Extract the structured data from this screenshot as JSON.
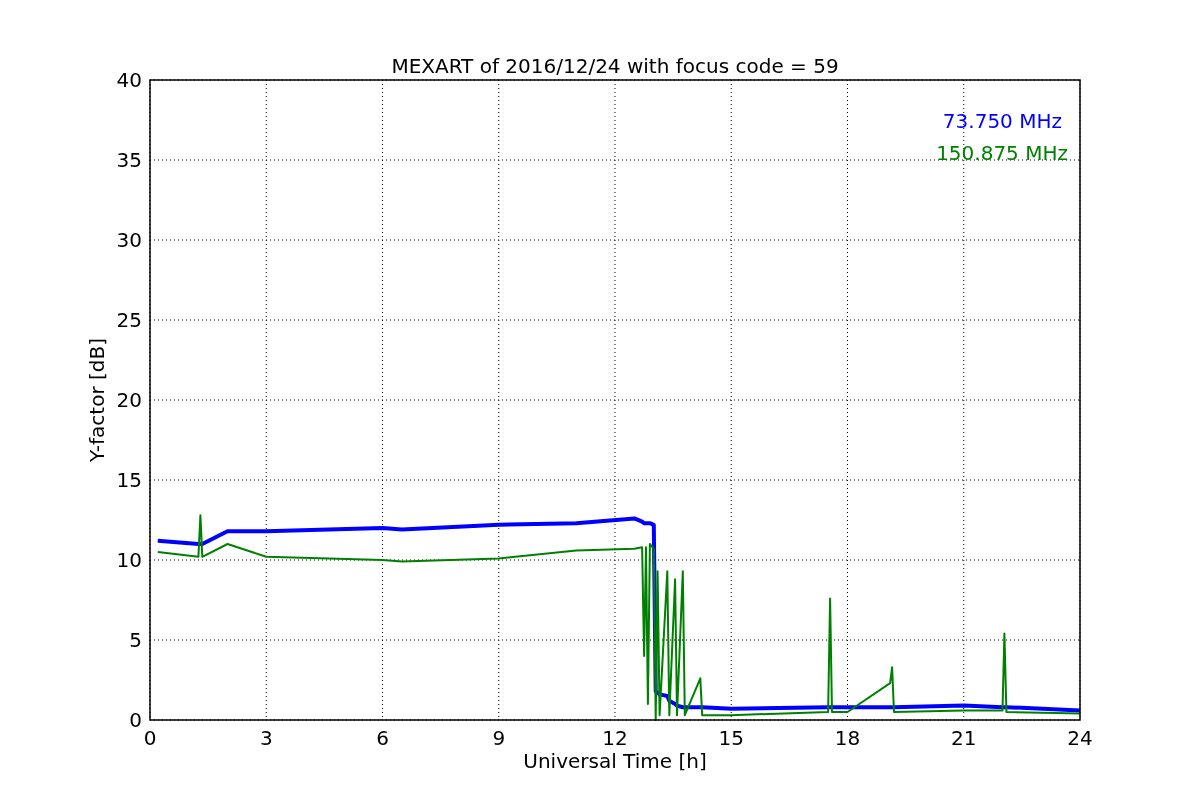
{
  "chart_data": {
    "type": "line",
    "grid": true,
    "title": "MEXART of 2016/12/24 with focus code = 59",
    "xlabel": "Universal Time [h]",
    "ylabel": "Y-factor [dB]",
    "xlim": [
      0,
      24
    ],
    "ylim": [
      0,
      40
    ],
    "xticks": [
      0,
      3,
      6,
      9,
      12,
      15,
      18,
      21,
      24
    ],
    "yticks": [
      0,
      5,
      10,
      15,
      20,
      25,
      30,
      35,
      40
    ],
    "x": [
      0.2,
      1.25,
      1.3,
      1.35,
      2,
      3,
      6,
      6.5,
      9,
      11,
      12.5,
      12.7,
      12.75,
      12.8,
      12.85,
      12.9,
      13.0,
      13.05,
      13.1,
      13.15,
      13.35,
      13.4,
      13.55,
      13.6,
      13.75,
      13.8,
      14.2,
      14.25,
      15,
      17.5,
      17.55,
      17.6,
      18,
      19.1,
      19.15,
      19.2,
      21,
      22.0,
      22.05,
      22.1,
      24
    ],
    "series": [
      {
        "name": "73.750 MHz",
        "color": "#0000ff",
        "values": [
          11.2,
          11,
          11,
          11,
          11.8,
          11.8,
          12,
          11.9,
          12.2,
          12.3,
          12.6,
          12.4,
          12.3,
          12.3,
          12.3,
          12.3,
          12.2,
          1.8,
          1.7,
          1.6,
          1.5,
          1.2,
          1.0,
          0.9,
          0.8,
          0.8,
          0.8,
          0.8,
          0.7,
          0.8,
          0.8,
          0.8,
          0.8,
          0.8,
          0.8,
          0.8,
          0.9,
          0.8,
          0.8,
          0.8,
          0.6
        ]
      },
      {
        "name": "150.875 MHz",
        "color": "#008000",
        "values": [
          10.5,
          10.2,
          12.8,
          10.2,
          11,
          10.2,
          10,
          9.9,
          10.1,
          10.6,
          10.7,
          10.8,
          4,
          10.8,
          1,
          11,
          10.7,
          0,
          9.3,
          0.3,
          9.3,
          0.3,
          8.8,
          0.3,
          9.3,
          0.3,
          2.6,
          0.3,
          0.3,
          0.5,
          7.6,
          0.5,
          0.5,
          2.3,
          3.3,
          0.5,
          0.6,
          0.6,
          5.4,
          0.5,
          0.4
        ]
      }
    ]
  }
}
